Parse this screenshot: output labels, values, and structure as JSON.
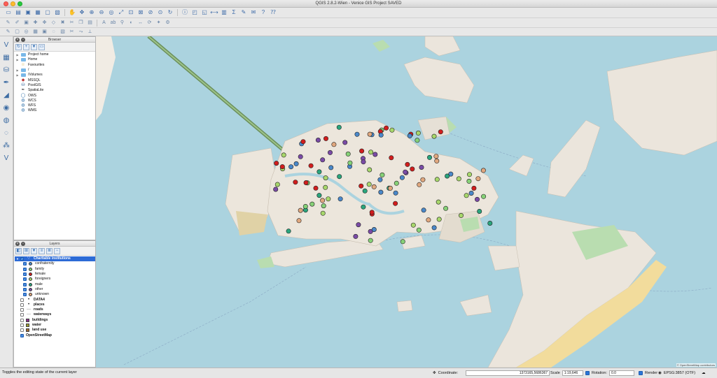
{
  "window": {
    "title": "QGIS 2.8.2-Wien - Venice GIS Project SAVED"
  },
  "toolbar_icons": [
    "new-project-icon",
    "open-project-icon",
    "save-project-icon",
    "save-as-icon",
    "print-composer-icon",
    "composer-manager-icon",
    "pan-icon",
    "pan-selection-icon",
    "zoom-in-icon",
    "zoom-out-icon",
    "zoom-actual-icon",
    "zoom-full-icon",
    "zoom-layer-icon",
    "zoom-selection-icon",
    "zoom-last-icon",
    "zoom-next-icon",
    "refresh-icon",
    "identify-icon",
    "select-icon",
    "deselect-icon",
    "measure-icon",
    "attribute-table-icon",
    "statistics-icon",
    "map-tips-icon",
    "annotation-icon",
    "help-icon",
    "whats-this-icon"
  ],
  "browser": {
    "title": "Browser",
    "items": [
      {
        "label": "Project home",
        "icon": "folder",
        "arrow": true
      },
      {
        "label": "Home",
        "icon": "folder",
        "arrow": true
      },
      {
        "label": "Favourites",
        "icon": "star",
        "arrow": false
      },
      {
        "label": "/",
        "icon": "folder",
        "arrow": true
      },
      {
        "label": "/Volumes",
        "icon": "folder",
        "arrow": true
      },
      {
        "label": "MSSQL",
        "icon": "db",
        "arrow": false
      },
      {
        "label": "PostGIS",
        "icon": "db",
        "arrow": false
      },
      {
        "label": "SpatiaLite",
        "icon": "db",
        "arrow": false
      },
      {
        "label": "OWS",
        "icon": "globe",
        "arrow": false
      },
      {
        "label": "WCS",
        "icon": "globe",
        "arrow": false
      },
      {
        "label": "WFS",
        "icon": "globe",
        "arrow": false
      },
      {
        "label": "WMS",
        "icon": "globe",
        "arrow": false
      }
    ]
  },
  "layers": {
    "title": "Layers",
    "group": {
      "label": "Charitable institutions",
      "checked": true
    },
    "categories": [
      {
        "label": "confraternity",
        "color": "#4a88c9",
        "checked": true
      },
      {
        "label": "family",
        "color": "#86d177",
        "checked": true
      },
      {
        "label": "female",
        "color": "#d11d1d",
        "checked": true
      },
      {
        "label": "foreigners",
        "color": "#a7d76b",
        "checked": true
      },
      {
        "label": "male",
        "color": "#2aa57d",
        "checked": true
      },
      {
        "label": "other",
        "color": "#7a4ba6",
        "checked": true
      },
      {
        "label": "unknown",
        "color": "#e0a77e",
        "checked": true
      }
    ],
    "others": [
      {
        "label": "DATA4",
        "symbol": "dot",
        "checked": false
      },
      {
        "label": "places",
        "symbol": "dot",
        "checked": false
      },
      {
        "label": "roads",
        "symbol": "line",
        "checked": false
      },
      {
        "label": "waterways",
        "symbol": "line",
        "checked": false
      },
      {
        "label": "buildings",
        "symbol": "fill",
        "color": "#8a2d8a",
        "checked": false
      },
      {
        "label": "water",
        "symbol": "fill",
        "color": "#9b9b2d",
        "checked": false
      },
      {
        "label": "land use",
        "symbol": "fill",
        "color": "#a26a2f",
        "checked": false
      },
      {
        "label": "OpenStreetMap",
        "symbol": "none",
        "checked": true
      }
    ]
  },
  "map": {
    "attribution": "© OpenStreetMap contributors"
  },
  "statusbar": {
    "message": "Toggles the editing state of the current layer",
    "coordinate_label": "Coordinate:",
    "coordinate_value": "1373165,5686367",
    "scale_label": "Scale",
    "scale_value": "1:19,646",
    "rotation_label": "Rotation:",
    "rotation_value": "0.0",
    "render_label": "Render",
    "crs": "EPSG:3857 (OTF)"
  }
}
